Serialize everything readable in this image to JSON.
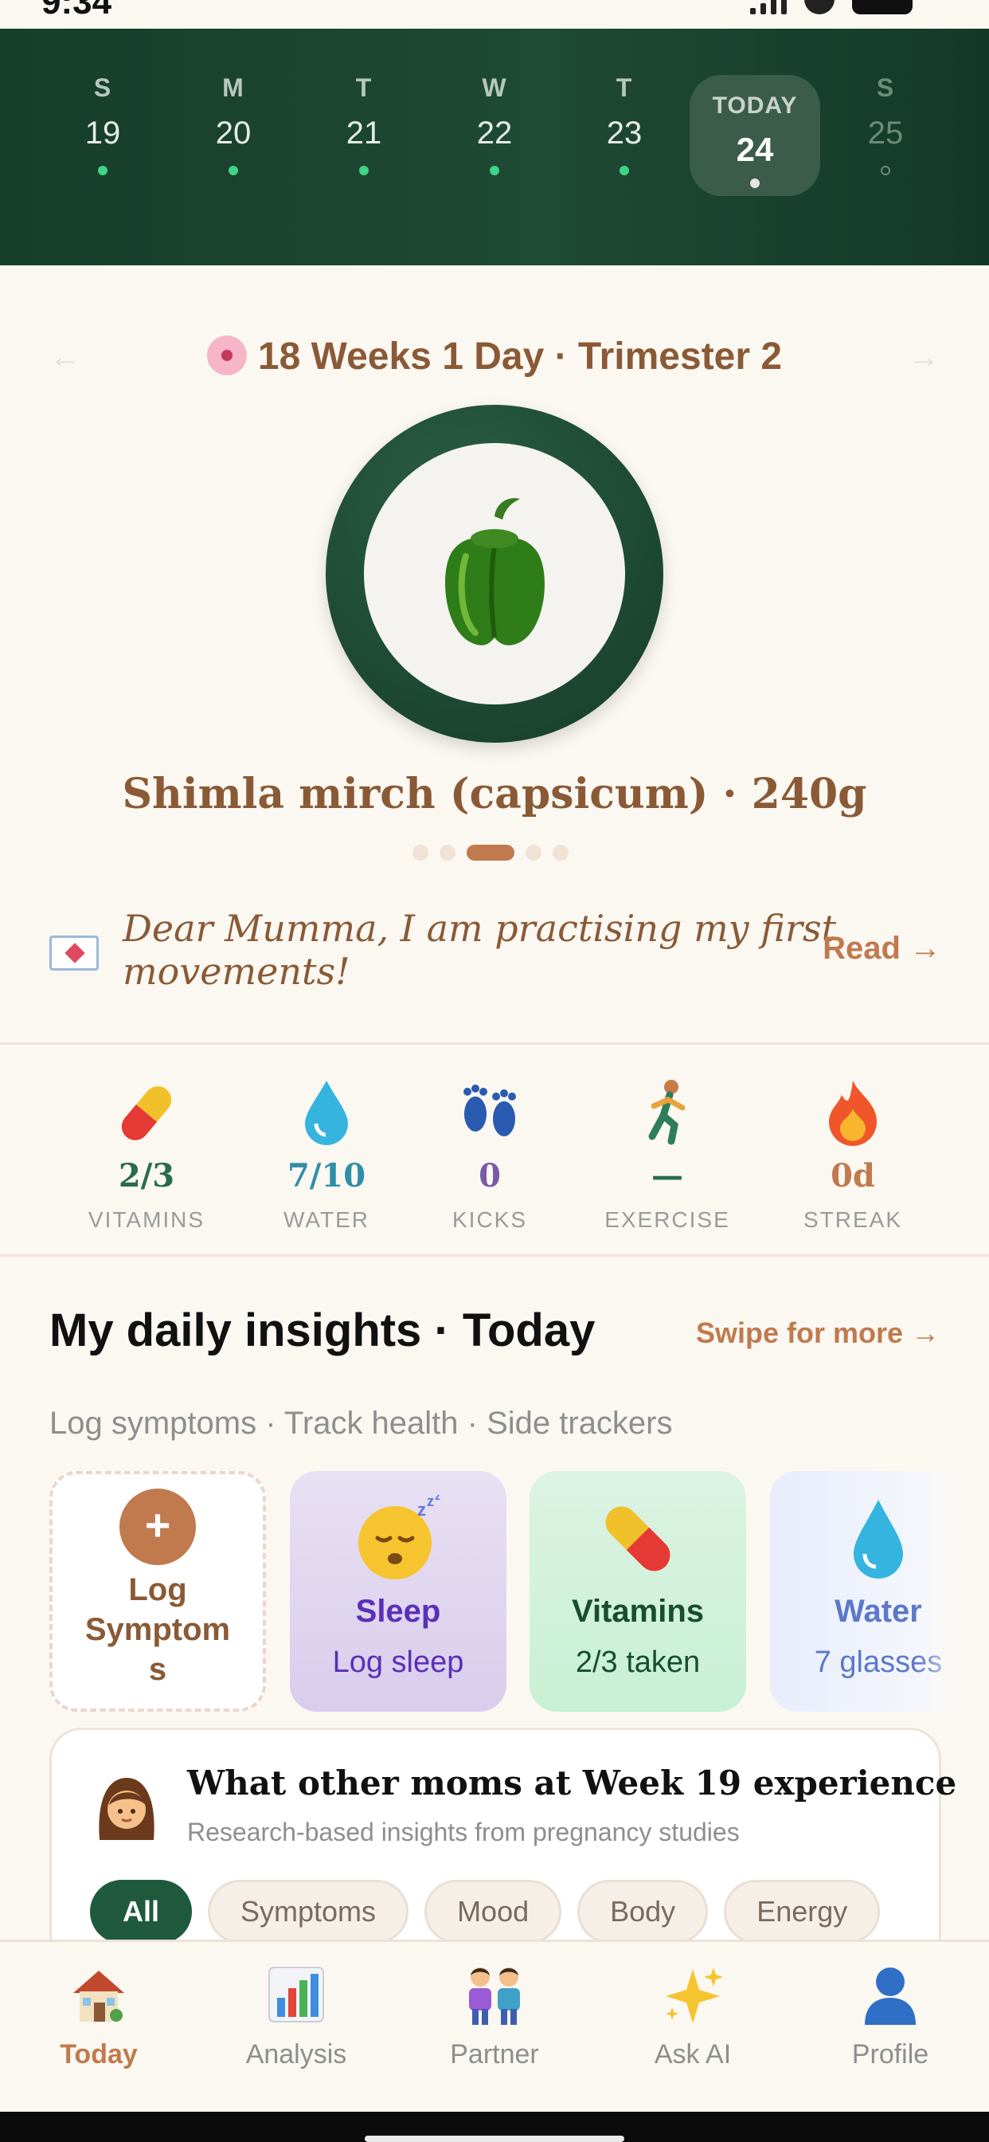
{
  "status": {
    "time": "9:34"
  },
  "week": {
    "days": [
      {
        "label": "S",
        "num": "19"
      },
      {
        "label": "M",
        "num": "20"
      },
      {
        "label": "T",
        "num": "21"
      },
      {
        "label": "W",
        "num": "22"
      },
      {
        "label": "T",
        "num": "23"
      },
      {
        "label": "TODAY",
        "num": "24"
      },
      {
        "label": "S",
        "num": "25"
      }
    ]
  },
  "pregnancy": {
    "prev_arrow": "←",
    "next_arrow": "→",
    "week_title": "18 Weeks 1 Day · Trimester 2",
    "fruit_name": "Shimla mirch (capsicum) · 240g",
    "pager_active_index": 2
  },
  "letter": {
    "text": "Dear Mumma, I am practising my first movements!",
    "read_label": "Read →"
  },
  "trackers": [
    {
      "value": "2/3",
      "label": "VITAMINS",
      "icon": "pill-icon",
      "color": "#2a6b4e"
    },
    {
      "value": "7/10",
      "label": "WATER",
      "icon": "water-drop-icon",
      "color": "#2f8fa8"
    },
    {
      "value": "0",
      "label": "KICKS",
      "icon": "footprints-icon",
      "color": "#7a5aa6"
    },
    {
      "value": "—",
      "label": "EXERCISE",
      "icon": "runner-icon",
      "color": "#2a6b4e"
    },
    {
      "value": "0d",
      "label": "STREAK",
      "icon": "fire-icon",
      "color": "#c07a4d"
    }
  ],
  "insights": {
    "title": "My daily insights · Today",
    "swipe": "Swipe for more →",
    "subtitle": "Log symptoms · Track health · Side trackers",
    "cards": {
      "log": {
        "plus": "+",
        "title": "Log Symptom s"
      },
      "sleep": {
        "title": "Sleep",
        "sub": "Log sleep"
      },
      "vitamins": {
        "title": "Vitamins",
        "sub": "2/3 taken"
      },
      "water": {
        "title": "Water",
        "sub": "7 glasses"
      }
    }
  },
  "moms": {
    "title": "What other moms at Week 19 experience",
    "subtitle": "Research-based insights from pregnancy studies",
    "chips": [
      "All",
      "Symptoms",
      "Mood",
      "Body",
      "Energy"
    ]
  },
  "tabs": [
    {
      "label": "Today",
      "icon": "home-icon",
      "active": true
    },
    {
      "label": "Analysis",
      "icon": "chart-icon",
      "active": false
    },
    {
      "label": "Partner",
      "icon": "couple-icon",
      "active": false
    },
    {
      "label": "Ask AI",
      "icon": "sparkles-icon",
      "active": false
    },
    {
      "label": "Profile",
      "icon": "profile-icon",
      "active": false
    }
  ]
}
